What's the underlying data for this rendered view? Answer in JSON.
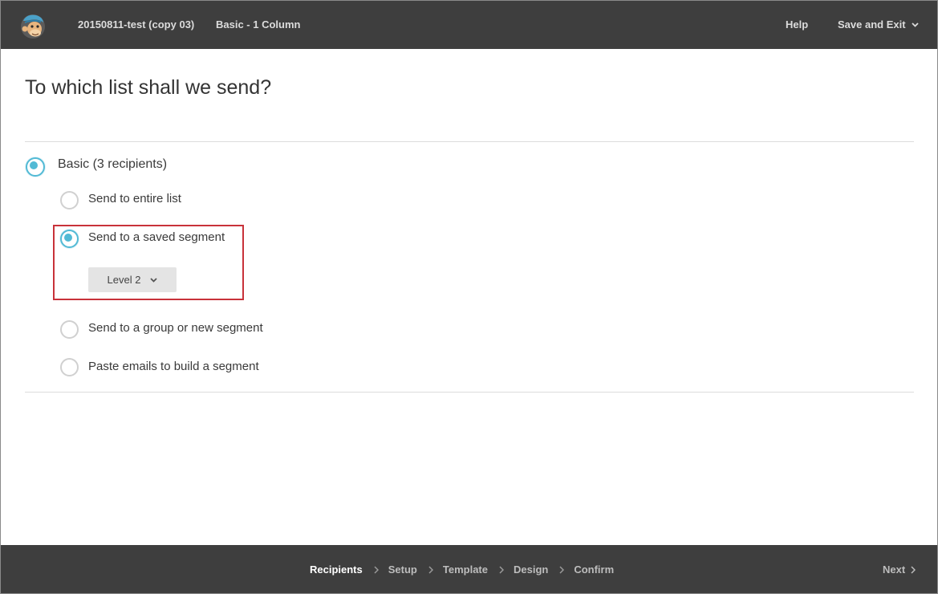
{
  "header": {
    "campaign_name": "20150811-test (copy 03)",
    "template_name": "Basic - 1 Column",
    "help_label": "Help",
    "save_exit_label": "Save and Exit",
    "logo_icon": "chimp-logo-icon"
  },
  "main": {
    "title": "To which list shall we send?",
    "list": {
      "label": "Basic (3 recipients)",
      "selected": true
    },
    "options": [
      {
        "label": "Send to entire list",
        "selected": false
      },
      {
        "label": "Send to a saved segment",
        "selected": true
      },
      {
        "label": "Send to a group or new segment",
        "selected": false
      },
      {
        "label": "Paste emails to build a segment",
        "selected": false
      }
    ],
    "segment_select": {
      "value": "Level 2"
    }
  },
  "footer": {
    "steps": [
      {
        "label": "Recipients",
        "active": true
      },
      {
        "label": "Setup",
        "active": false
      },
      {
        "label": "Template",
        "active": false
      },
      {
        "label": "Design",
        "active": false
      },
      {
        "label": "Confirm",
        "active": false
      }
    ],
    "next_label": "Next"
  },
  "colors": {
    "topbar_bg": "#3e3e3e",
    "radio_accent": "#52bad5",
    "highlight_border": "#c8323a",
    "select_bg": "#e4e4e4"
  }
}
